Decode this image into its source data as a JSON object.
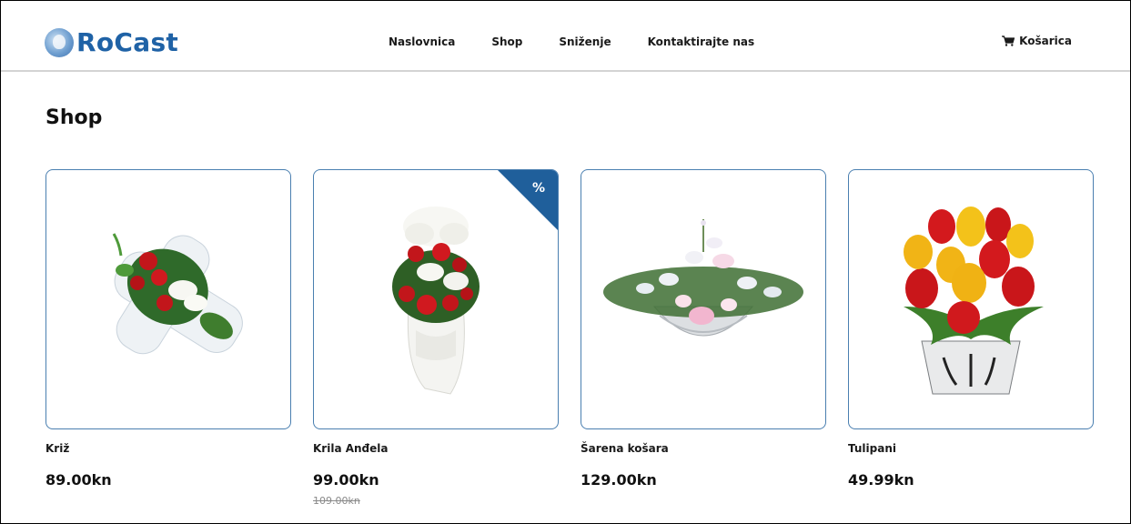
{
  "brand": {
    "name": "RoCast"
  },
  "nav": {
    "items": [
      {
        "label": "Naslovnica"
      },
      {
        "label": "Shop"
      },
      {
        "label": "Sniženje"
      },
      {
        "label": "Kontaktirajte nas"
      }
    ]
  },
  "cart": {
    "label": "Košarica",
    "icon": "cart-icon"
  },
  "page": {
    "title": "Shop"
  },
  "products": [
    {
      "name": "Križ",
      "price": "89.00kn"
    },
    {
      "name": "Krila Anđela",
      "price": "99.00kn",
      "old_price": "109.00kn",
      "badge": "%"
    },
    {
      "name": "Šarena košara",
      "price": "129.00kn"
    },
    {
      "name": "Tulipani",
      "price": "49.99kn"
    }
  ],
  "colors": {
    "accent": "#1f62a6",
    "sale_badge": "#1f5f9b",
    "card_border": "#4a7fb0",
    "header_border": "#d4d4d4"
  }
}
